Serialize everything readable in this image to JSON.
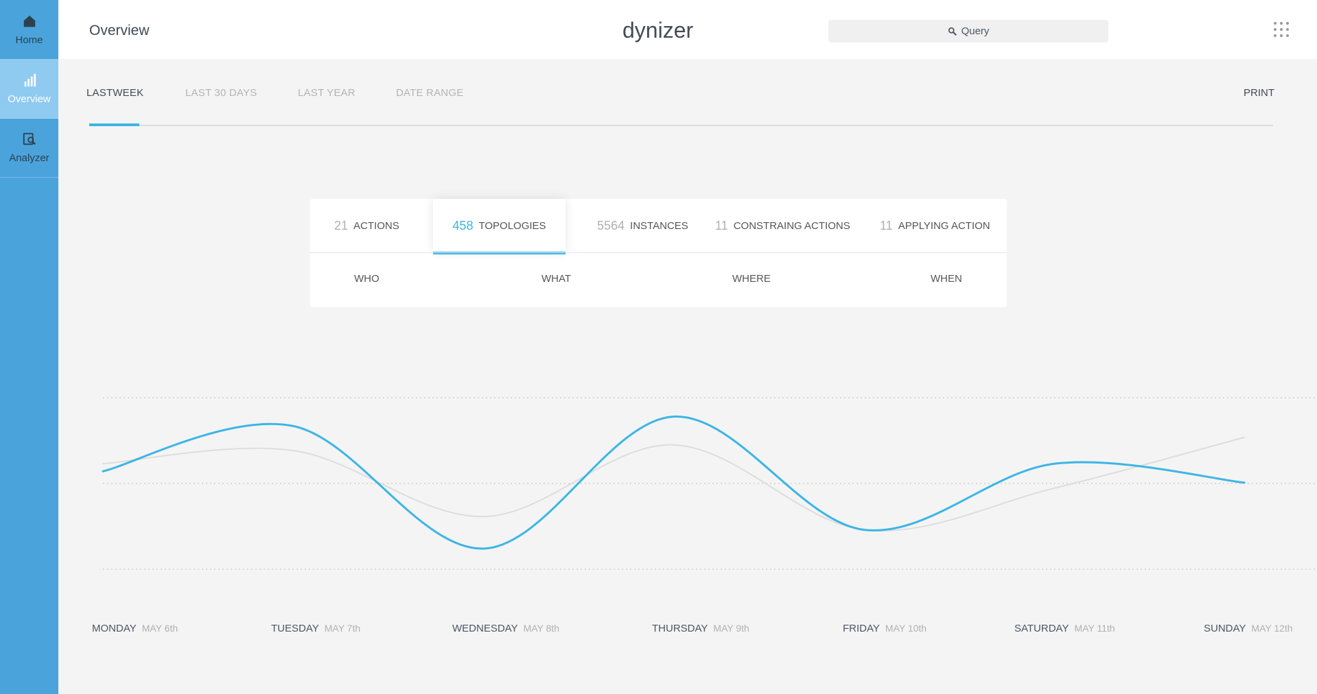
{
  "sidebar": {
    "items": [
      {
        "label": "Home",
        "icon": "home-icon",
        "active": false
      },
      {
        "label": "Overview",
        "icon": "bar-chart-icon",
        "active": true
      },
      {
        "label": "Analyzer",
        "icon": "analyzer-icon",
        "active": false
      }
    ]
  },
  "header": {
    "title": "Overview",
    "logo_text": "dynizer",
    "search_placeholder": "Query"
  },
  "date_tabs": [
    {
      "label": "LASTWEEK",
      "active": true
    },
    {
      "label": "LAST 30 DAYS",
      "active": false
    },
    {
      "label": "LAST YEAR",
      "active": false
    },
    {
      "label": "DATE RANGE",
      "active": false
    }
  ],
  "print_label": "PRINT",
  "stats": [
    {
      "value": "21",
      "label": "ACTIONS",
      "active": false
    },
    {
      "value": "458",
      "label": "TOPOLOGIES",
      "active": true
    },
    {
      "value": "5564",
      "label": "INSTANCES",
      "active": false
    },
    {
      "value": "11",
      "label": "CONSTRAING ACTIONS",
      "active": false
    },
    {
      "value": "11",
      "label": "APPLYING ACTION",
      "active": false
    }
  ],
  "dimensions": [
    "WHO",
    "WHAT",
    "WHERE",
    "WHEN"
  ],
  "colors": {
    "accent": "#3cb5e5",
    "sidebar": "#4aa3db",
    "sidebar_active": "#8fcaf0",
    "secondary_line": "#dddddd"
  },
  "chart_data": {
    "type": "line",
    "categories": [
      "MONDAY",
      "TUESDAY",
      "WEDNESDAY",
      "THURSDAY",
      "FRIDAY",
      "SATURDAY",
      "SUNDAY"
    ],
    "dates": [
      "MAY 6th",
      "MAY 7th",
      "MAY 8th",
      "MAY 9th",
      "MAY 10th",
      "MAY 11th",
      "MAY 12th"
    ],
    "grid": "dotted horizontal",
    "series": [
      {
        "values": [
          0.61,
          0.85,
          0.2,
          0.9,
          0.3,
          0.65,
          0.55
        ],
        "color": "#3cb5e5",
        "emphasis": true
      },
      {
        "values": [
          0.65,
          0.72,
          0.37,
          0.75,
          0.3,
          0.52,
          0.79
        ],
        "color": "#dddddd",
        "emphasis": false
      }
    ]
  }
}
